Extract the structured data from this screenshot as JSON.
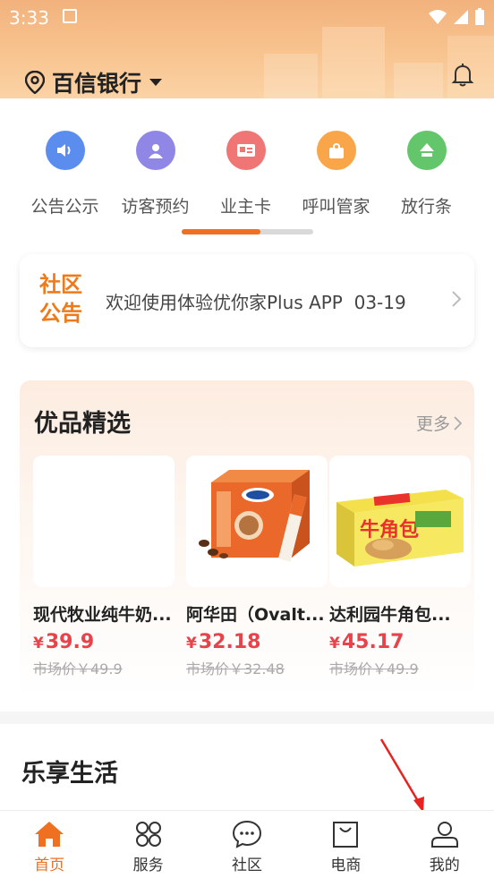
{
  "status_bar": {
    "time": "3:33"
  },
  "header": {
    "location": "百信银行",
    "colors": {
      "accent": "#f07021"
    }
  },
  "quick_actions": [
    {
      "label": "公告公示",
      "icon": "speaker-icon",
      "color": "#5b8def"
    },
    {
      "label": "访客预约",
      "icon": "visitor-icon",
      "color": "#8f86e6"
    },
    {
      "label": "业主卡",
      "icon": "card-icon",
      "color": "#f07575"
    },
    {
      "label": "呼叫管家",
      "icon": "butler-icon",
      "color": "#f9a64a"
    },
    {
      "label": "放行条",
      "icon": "upload-arrow-icon",
      "color": "#63c66a"
    }
  ],
  "pager": {
    "progress": 0.6
  },
  "notice": {
    "tag": "社区公告",
    "text": "欢迎使用体验优你家Plus APP",
    "date": "03-19"
  },
  "selection": {
    "title": "优品精选",
    "more": "更多",
    "products": [
      {
        "name": "现代牧业纯牛奶...",
        "currency": "¥",
        "price": "39.9",
        "market": "市场价￥49.9"
      },
      {
        "name": "阿华田（Ovalt...",
        "currency": "¥",
        "price": "32.18",
        "market": "市场价￥32.48"
      },
      {
        "name": "达利园牛角包...",
        "currency": "¥",
        "price": "45.17",
        "market": "市场价￥49.9"
      }
    ]
  },
  "life": {
    "title": "乐享生活"
  },
  "tabbar": [
    {
      "label": "首页",
      "icon": "home-icon",
      "active": true
    },
    {
      "label": "服务",
      "icon": "services-grid-icon",
      "active": false
    },
    {
      "label": "社区",
      "icon": "chat-bubble-icon",
      "active": false
    },
    {
      "label": "电商",
      "icon": "shopping-bag-icon",
      "active": false
    },
    {
      "label": "我的",
      "icon": "profile-icon",
      "active": false
    }
  ]
}
